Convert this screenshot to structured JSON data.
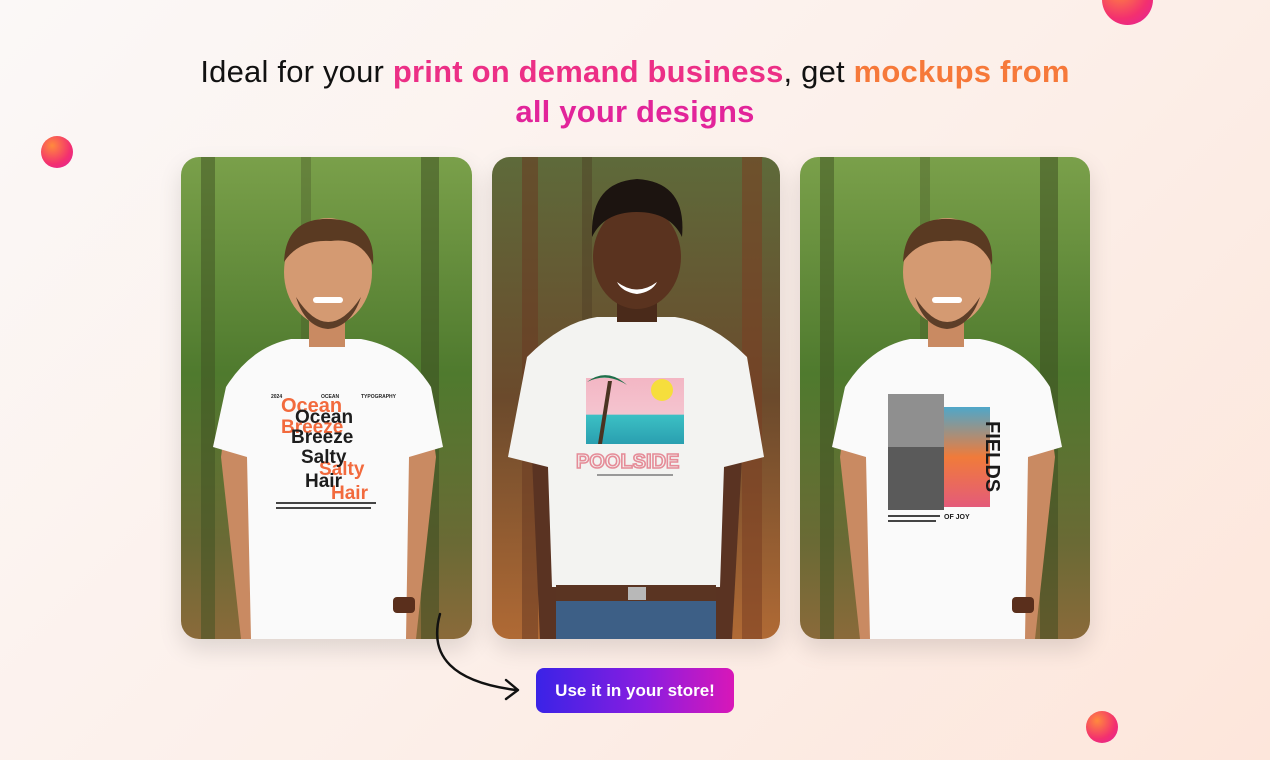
{
  "headline": {
    "part1": "Ideal for your ",
    "highlight1": "print on demand business",
    "part2": ", get ",
    "highlight2": "mockups from",
    "highlight3": "all your designs"
  },
  "mockups": [
    {
      "model": "smiling bearded man in white t-shirt, forest background",
      "design_lines": [
        "Ocean",
        "Breeze",
        "Salty",
        "Hair"
      ],
      "design_echo": [
        "Ocean",
        "Breeze",
        "Salty",
        "Hair"
      ],
      "small_left": "2024",
      "small_center": "OCEAN",
      "small_right": "TYPOGRAPHY"
    },
    {
      "model": "smiling young man in white t-shirt, forest background",
      "design_title": "POOLSIDE"
    },
    {
      "model": "smiling bearded man in white t-shirt, forest background",
      "design_title": "FIELDS",
      "design_subtitle": "OF JOY"
    }
  ],
  "cta": {
    "label": "Use it in your store!"
  },
  "colors": {
    "pink": "#ec2f86",
    "orange": "#f6793a",
    "magenta": "#e2249a",
    "button_start": "#3a23e6",
    "button_end": "#d817b8"
  },
  "icons": [
    "curved-arrow-icon"
  ]
}
